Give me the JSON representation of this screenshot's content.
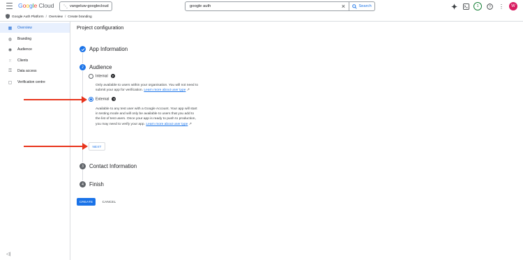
{
  "topbar": {
    "logo_letters": [
      "G",
      "o",
      "o",
      "g",
      "l",
      "e"
    ],
    "logo_suffix": "Cloud",
    "project": "vangeluw-googlecloud",
    "search_value": "google auth",
    "search_button": "Search",
    "notifications_count": "1",
    "avatar_initial": "W",
    "icons": [
      "menu-icon",
      "gemini-icon",
      "terminal-icon",
      "help-icon",
      "more-vert-icon"
    ]
  },
  "breadcrumb": {
    "items": [
      "Google Auth Platform",
      "Overview",
      "Create branding"
    ]
  },
  "sidebar": {
    "items": [
      {
        "label": "Overview",
        "icon": "dashboard-icon",
        "active": true
      },
      {
        "label": "Branding",
        "icon": "palette-icon",
        "active": false
      },
      {
        "label": "Audience",
        "icon": "person-icon",
        "active": false
      },
      {
        "label": "Clients",
        "icon": "apps-icon",
        "active": false
      },
      {
        "label": "Data access",
        "icon": "data-access-icon",
        "active": false
      },
      {
        "label": "Verification centre",
        "icon": "verification-icon",
        "active": false
      }
    ]
  },
  "main": {
    "title": "Project configuration",
    "steps": [
      {
        "number": "1",
        "title": "App Information",
        "state": "done"
      },
      {
        "number": "2",
        "title": "Audience",
        "state": "current"
      },
      {
        "number": "3",
        "title": "Contact Information",
        "state": "pending"
      },
      {
        "number": "4",
        "title": "Finish",
        "state": "pending"
      }
    ],
    "audience": {
      "internal": {
        "label": "Internal",
        "selected": false,
        "desc_line1": "Only available to users within your organisation. You will not need to",
        "desc_line2_prefix": "submit your app for verification. ",
        "link": "Learn more about user type"
      },
      "external": {
        "label": "External",
        "selected": true,
        "desc_line1": "Available to any test user with a Google Account. Your app will start",
        "desc_line2": "in testing mode and will only be available to users that you add to",
        "desc_line3": "the list of test users. Once your app is ready to push to production,",
        "desc_line4_prefix": "you may need to verify your app. ",
        "link": "Learn more about user type"
      },
      "help_glyph": "?",
      "next_button": "NEXT"
    },
    "create_button": "CREATE",
    "cancel_button": "CANCEL"
  },
  "colors": {
    "accent": "#1a73e8",
    "annotation_arrow": "#e8341c",
    "avatar": "#d81b60",
    "active_nav_bg": "#e8f0fe"
  }
}
